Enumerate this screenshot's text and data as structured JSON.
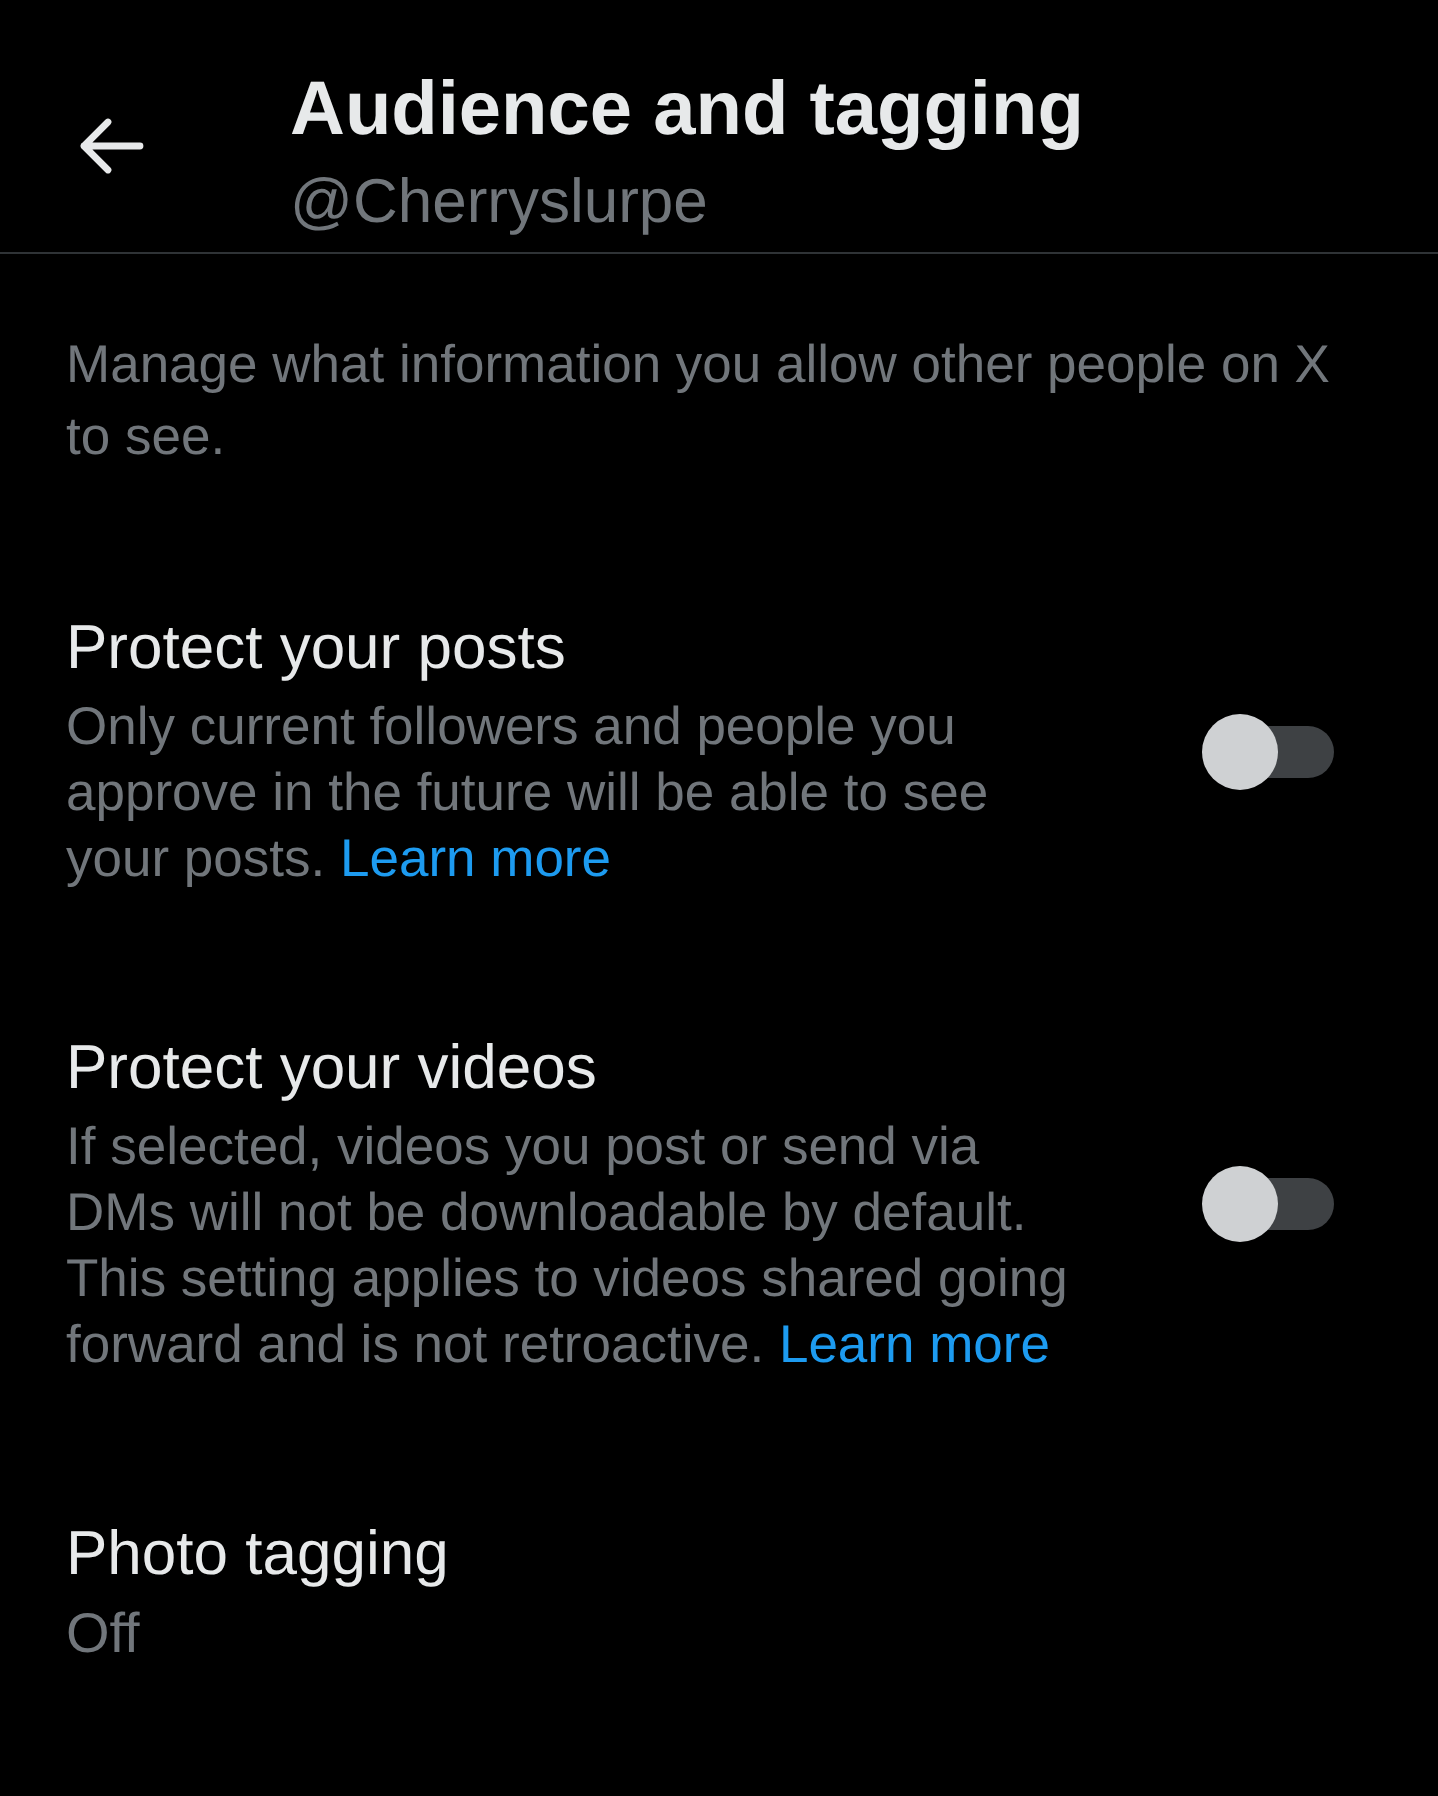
{
  "header": {
    "title": "Audience and tagging",
    "handle": "@Cherryslurpe"
  },
  "intro": "Manage what information you allow other people on X to see.",
  "settings": [
    {
      "kind": "toggle",
      "title": "Protect your posts",
      "description": "Only current followers and people you approve in the future will be able to see your posts.",
      "link": "Learn more",
      "on": false
    },
    {
      "kind": "toggle",
      "title": "Protect your videos",
      "description": "If selected, videos you post or send via DMs will not be downloadable by default. This setting applies to videos shared going forward and is not retroactive.",
      "link": "Learn more",
      "on": false
    },
    {
      "kind": "value",
      "title": "Photo tagging",
      "value": "Off"
    }
  ]
}
